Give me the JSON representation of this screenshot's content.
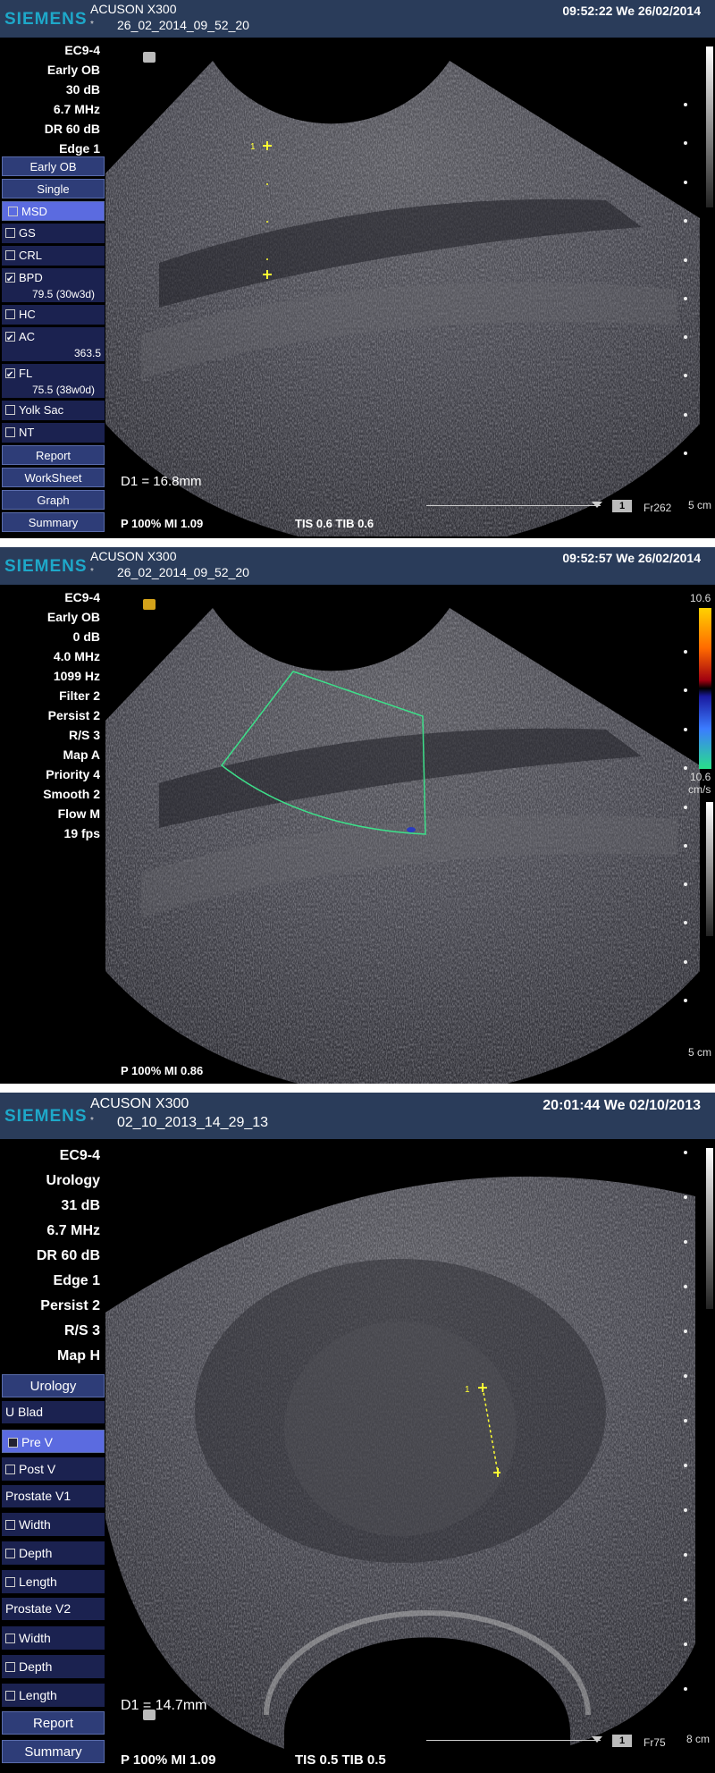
{
  "screens": [
    {
      "brand": "SIEMENS",
      "model": "ACUSON X300",
      "star": "*",
      "study": "26_02_2014_09_52_20",
      "datetime": "09:52:22  We  26/02/2014",
      "params": [
        "EC9-4",
        "Early OB",
        "30 dB",
        "6.7 MHz",
        "DR 60 dB",
        "Edge 1"
      ],
      "menu": {
        "app": "Early OB",
        "mode": "Single",
        "msd": "MSD",
        "gs": "GS",
        "crl": "CRL",
        "bpd": "BPD",
        "bpd_value": "79.5 (30w3d)",
        "hc": "HC",
        "ac": "AC",
        "ac_value": "363.5",
        "fl": "FL",
        "fl_value": "75.5 (38w0d)",
        "yolk": "Yolk Sac",
        "nt": "NT",
        "report": "Report",
        "worksheet": "WorkSheet",
        "graph": "Graph",
        "summary": "Summary"
      },
      "measurement": "D1 = 16.8mm",
      "marker_label": "1",
      "bottom": "P 100%   MI 1.09",
      "tis_tib": "TIS 0.6   TIB 0.6",
      "frame_box": "1",
      "frame_rate": "Fr262",
      "depth": "5 cm"
    },
    {
      "brand": "SIEMENS",
      "model": "ACUSON X300",
      "star": "*",
      "study": "26_02_2014_09_52_20",
      "datetime": "09:52:57  We  26/02/2014",
      "params": [
        "EC9-4",
        "Early OB",
        "0 dB",
        "4.0 MHz",
        "1099 Hz",
        "Filter 2",
        "Persist 2",
        "R/S 3",
        "Map A",
        "Priority 4",
        "Smooth 2",
        "Flow M",
        "19 fps"
      ],
      "scale_top": "10.6",
      "scale_bottom": "10.6",
      "scale_unit": "cm/s",
      "bottom": "P 100%   MI 0.86",
      "depth": "5 cm"
    },
    {
      "brand": "SIEMENS",
      "model": "ACUSON X300",
      "star": "*",
      "study": "02_10_2013_14_29_13",
      "datetime": "20:01:44  We  02/10/2013",
      "params": [
        "EC9-4",
        "Urology",
        "31 dB",
        "6.7 MHz",
        "DR 60 dB",
        "Edge 1",
        "Persist 2",
        "R/S 3",
        "Map H"
      ],
      "menu": {
        "app": "Urology",
        "ublad": "U Blad",
        "prev": "Pre V",
        "postv": "Post V",
        "pv1": "Prostate V1",
        "width1": "Width",
        "depth1": "Depth",
        "length1": "Length",
        "pv2": "Prostate V2",
        "width2": "Width",
        "depth2": "Depth",
        "length2": "Length",
        "report": "Report",
        "summary": "Summary"
      },
      "measurement": "D1 = 14.7mm",
      "marker_label": "1",
      "bottom": "P 100%   MI 1.09",
      "tis_tib": "TIS 0.5   TIB 0.5",
      "frame_box": "1",
      "frame_rate": "Fr75",
      "depth": "8 cm"
    }
  ],
  "colors": {
    "topbar": "#2a3c5a",
    "brand": "#1ea8c9",
    "menu_button": "#2e3d78",
    "menu_selected": "#5b6be0",
    "caliper": "#ffff33",
    "color_box": "#3de08a"
  }
}
